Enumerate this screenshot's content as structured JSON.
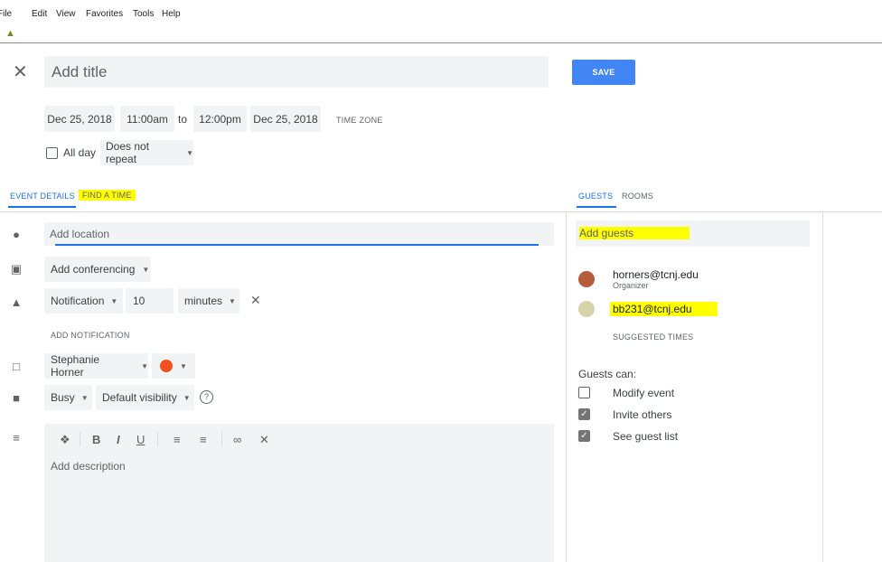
{
  "menubar": {
    "items": [
      "File",
      "Edit",
      "View",
      "Favorites",
      "Tools",
      "Help"
    ]
  },
  "event": {
    "title_placeholder": "Add title",
    "save_label": "SAVE",
    "start_date": "Dec 25, 2018",
    "start_time": "11:00am",
    "to_label": "to",
    "end_time": "12:00pm",
    "end_date": "Dec 25, 2018",
    "timezone_label": "TIME ZONE",
    "all_day_label": "All day",
    "repeat_label": "Does not repeat"
  },
  "tabs": {
    "event_details": "EVENT DETAILS",
    "find_a_time": "FIND A TIME",
    "guests": "GUESTS",
    "rooms": "ROOMS"
  },
  "details": {
    "location_placeholder": "Add location",
    "conferencing_label": "Add conferencing",
    "notification_type": "Notification",
    "notification_value": "10",
    "notification_unit": "minutes",
    "add_notification_label": "ADD NOTIFICATION",
    "calendar_owner": "Stephanie Horner",
    "calendar_color": "#f4511e",
    "busy_label": "Busy",
    "visibility_label": "Default visibility",
    "description_placeholder": "Add description"
  },
  "guests": {
    "add_placeholder": "Add guests",
    "list": [
      {
        "email": "horners@tcnj.edu",
        "role": "Organizer"
      },
      {
        "email": "bb231@tcnj.edu",
        "role": ""
      }
    ],
    "suggested_times_label": "SUGGESTED TIMES",
    "guests_can_label": "Guests can:",
    "permissions": [
      {
        "label": "Modify event",
        "checked": false
      },
      {
        "label": "Invite others",
        "checked": true
      },
      {
        "label": "See guest list",
        "checked": true
      }
    ]
  },
  "colors": {
    "accent": "#4285f4",
    "highlight": "#ffff00",
    "field_bg": "#f1f3f4"
  }
}
